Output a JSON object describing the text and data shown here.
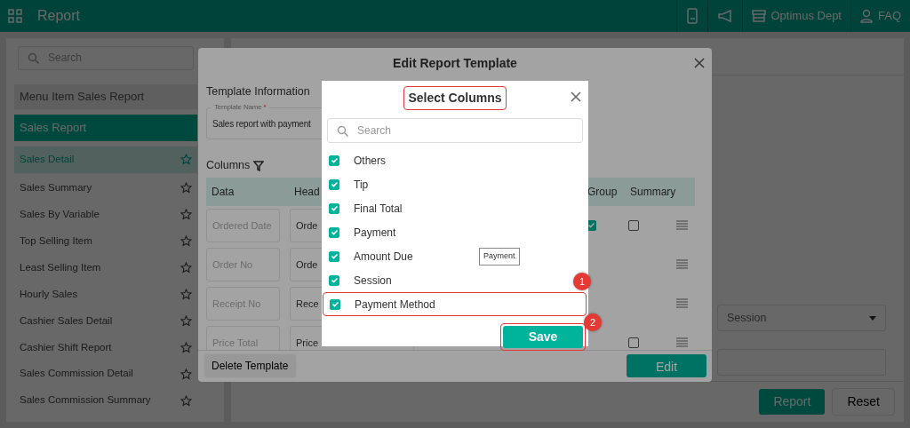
{
  "topbar": {
    "title": "Report",
    "store": "Optimus Dept",
    "user": "FAQ"
  },
  "sidebar": {
    "search_placeholder": "Search",
    "groups": [
      {
        "label": "Menu Item Sales Report",
        "selected": false
      },
      {
        "label": "Sales Report",
        "selected": true
      }
    ],
    "items": [
      {
        "label": "Sales Detail",
        "selected": true
      },
      {
        "label": "Sales Summary",
        "selected": false
      },
      {
        "label": "Sales By Variable",
        "selected": false
      },
      {
        "label": "Top Selling Item",
        "selected": false
      },
      {
        "label": "Least Selling Item",
        "selected": false
      },
      {
        "label": "Hourly Sales",
        "selected": false
      },
      {
        "label": "Cashier Sales Detail",
        "selected": false
      },
      {
        "label": "Cashier Shift Report",
        "selected": false
      },
      {
        "label": "Sales Commission Detail",
        "selected": false
      },
      {
        "label": "Sales Commission Summary",
        "selected": false
      }
    ]
  },
  "main": {
    "session_select": "Session",
    "report_button": "Report",
    "reset_button": "Reset"
  },
  "edit_modal": {
    "title": "Edit Report Template",
    "section": "Template Information",
    "template_name": {
      "label": "Template Name",
      "required_mark": "*",
      "value": "Sales report with payment"
    },
    "columns_title": "Columns",
    "table": {
      "columns": [
        "Data",
        "Head",
        "Group",
        "Summary"
      ],
      "rows": [
        {
          "data": "Ordered Date",
          "header": "Orde",
          "group": true,
          "summary": false
        },
        {
          "data": "Order No",
          "header": "Orde"
        },
        {
          "data": "Receipt No",
          "header": "Rece"
        },
        {
          "data": "Price Total",
          "header": "Price",
          "summary": false
        }
      ]
    },
    "delete_button": "Delete Template",
    "edit_button": "Edit"
  },
  "select_modal": {
    "title": {
      "text": "Select Columns",
      "highlighted": true
    },
    "search_placeholder": "Search",
    "items": [
      {
        "label": "Others",
        "checked": true,
        "highlighted": false
      },
      {
        "label": "Tip",
        "checked": true,
        "highlighted": false
      },
      {
        "label": "Final Total",
        "checked": true,
        "highlighted": false
      },
      {
        "label": "Payment",
        "checked": true,
        "highlighted": false
      },
      {
        "label": "Amount Due",
        "checked": true,
        "highlighted": false
      },
      {
        "label": "Session",
        "checked": true,
        "highlighted": false
      },
      {
        "label": "Payment Method",
        "checked": true,
        "highlighted": true,
        "annotation": "1"
      }
    ],
    "tooltip": "Payment",
    "save_button": {
      "label": "Save",
      "highlighted": true,
      "annotation": "2"
    }
  }
}
